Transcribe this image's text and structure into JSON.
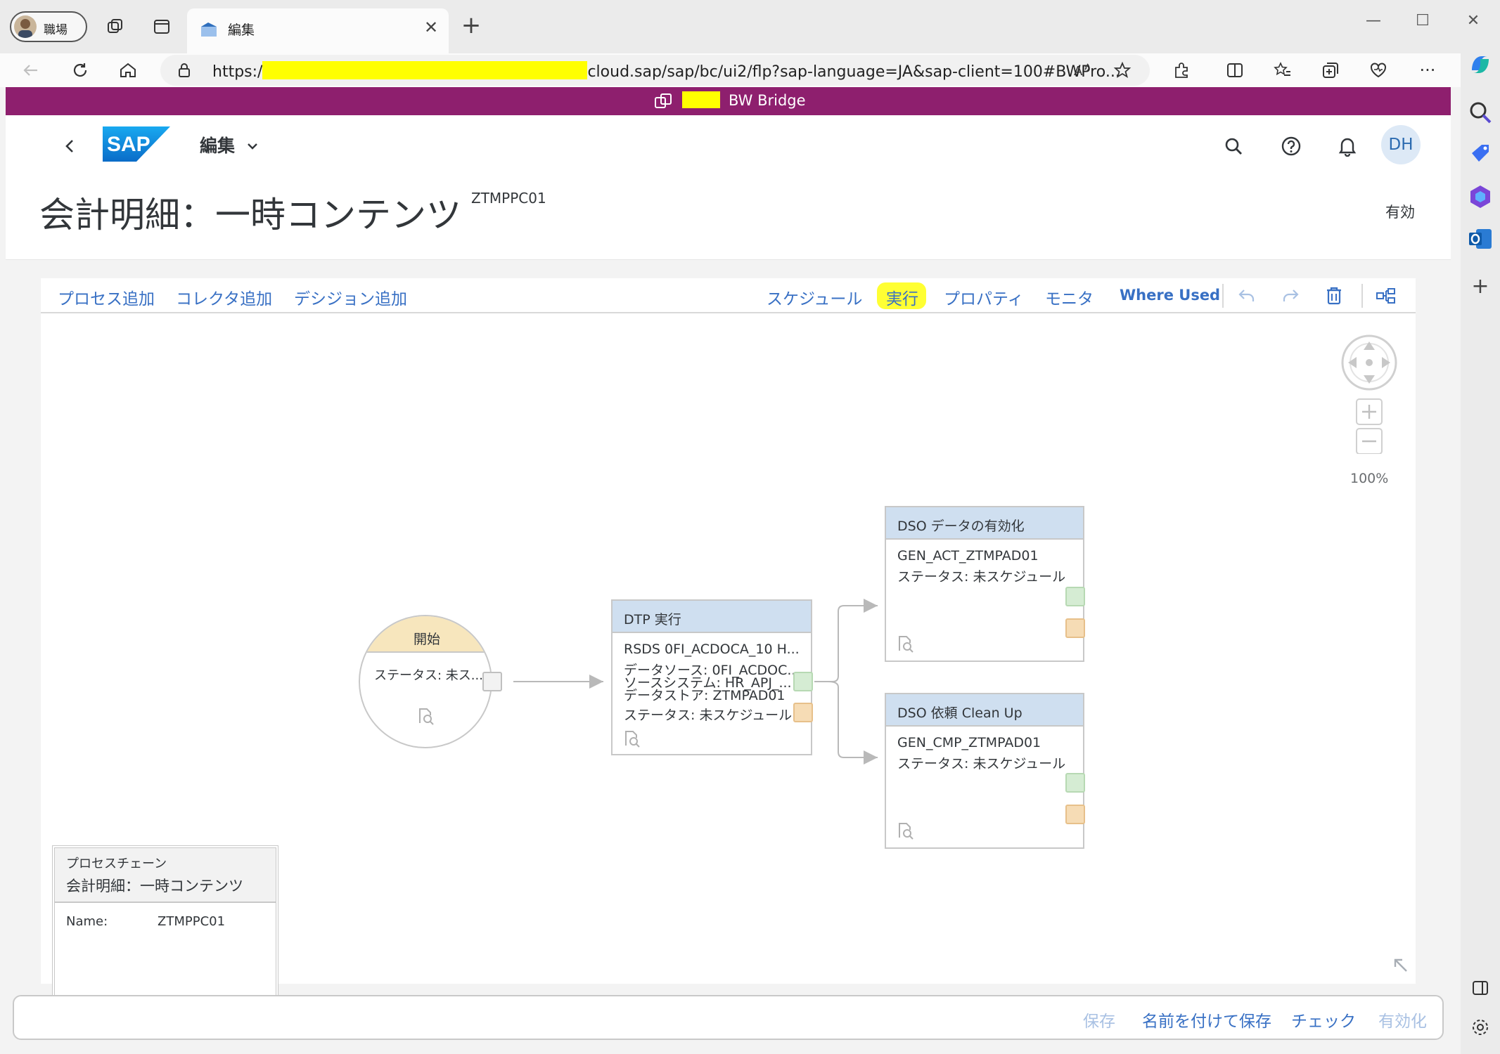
{
  "browser": {
    "profile_label": "職場",
    "tab_title": "編集",
    "url_prefix": "https:/",
    "url_rest": "cloud.sap/sap/bc/ui2/flp?sap-language=JA&sap-client=100#BWPro...",
    "icons": [
      "workspaces-icon",
      "tab-actions-icon",
      "back-icon",
      "refresh-icon",
      "home-icon",
      "lock-icon",
      "read-aloud-icon",
      "favorite-icon",
      "extensions-icon",
      "split-screen-icon",
      "favorites-icon",
      "collections-icon",
      "health-icon",
      "more-icon",
      "copilot-icon"
    ]
  },
  "shell": {
    "title": "BW Bridge",
    "bar_color": "#8e1f6e"
  },
  "header": {
    "logo_text": "SAP",
    "menu_label": "編集",
    "avatar_initials": "DH",
    "page_title": "会計明細：一時コンテンツ",
    "page_id": "ZTMPPC01",
    "status": "有効"
  },
  "toolbar": {
    "add_process": "プロセス追加",
    "add_collector": "コレクタ追加",
    "add_decision": "デシジョン追加",
    "schedule": "スケジュール",
    "run": "実行",
    "properties": "プロパティ",
    "monitor": "モニタ",
    "where_used": "Where Used",
    "link_color": "#3870c4"
  },
  "canvas": {
    "zoom": "100%",
    "start_node": {
      "title": "開始",
      "status": "ステータス: 未ス..."
    },
    "dtp_node": {
      "title": "DTP 実行",
      "lines": [
        "RSDS 0FI_ACDOCA_10 H...",
        "データソース: 0FI_ACDOC...",
        "ソースシステム: HR_APJ_...",
        "データストア: ZTMPAD01",
        "ステータス: 未スケジュール"
      ]
    },
    "activate_node": {
      "title": "DSO データの有効化",
      "lines": [
        "GEN_ACT_ZTMPAD01",
        "ステータス: 未スケジュール"
      ]
    },
    "cleanup_node": {
      "title": "DSO 依頼 Clean Up",
      "lines": [
        "GEN_CMP_ZTMPAD01",
        "ステータス: 未スケジュール"
      ]
    },
    "chain_info": {
      "heading": "プロセスチェーン",
      "name_title": "会計明細：一時コンテンツ",
      "name_label": "Name:",
      "name_value": "ZTMPPC01"
    }
  },
  "footer": {
    "save": "保存",
    "save_as": "名前を付けて保存",
    "check": "チェック",
    "activate": "有効化"
  }
}
